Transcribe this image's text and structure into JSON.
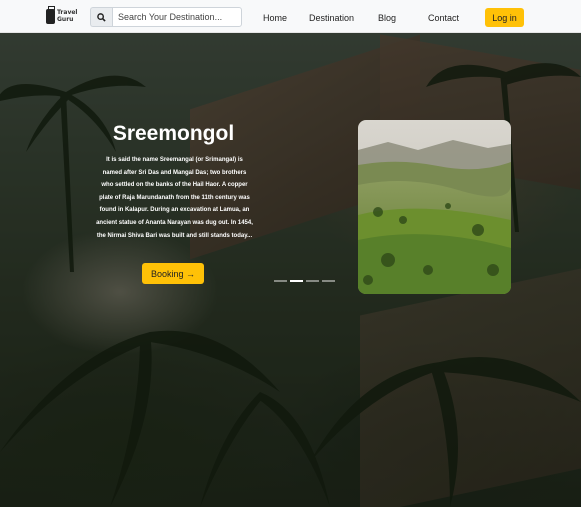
{
  "brand": {
    "logo_text": "Travel\nGuru"
  },
  "search": {
    "placeholder": "Search Your Destination...",
    "icon": "search-icon"
  },
  "nav": {
    "links": [
      "Home",
      "Destination",
      "Blog",
      "Contact"
    ],
    "login_label": "Log in"
  },
  "slide": {
    "title": "Sreemongol",
    "description": "It is said the name Sreemangal (or Srimangal) is named after Sri Das and Mangal Das; two brothers who settled on the banks of the Hail Haor. A copper plate of Raja Marundanath from the 11th century was found in Kalapur. During an excavation at Lamua, an ancient statue of Ananta Narayan was dug out. In 1454, the Nirmai Shiva Bari was built and still stands today...",
    "booking_label": "Booking",
    "booking_icon": "→",
    "active_index": 1,
    "total_slides": 4
  },
  "carousel": {
    "prev_icon": "chevron-left-icon",
    "next_icon": "chevron-right-icon"
  },
  "colors": {
    "accent": "#ffc107",
    "nav_bg": "#f8f9fa"
  }
}
